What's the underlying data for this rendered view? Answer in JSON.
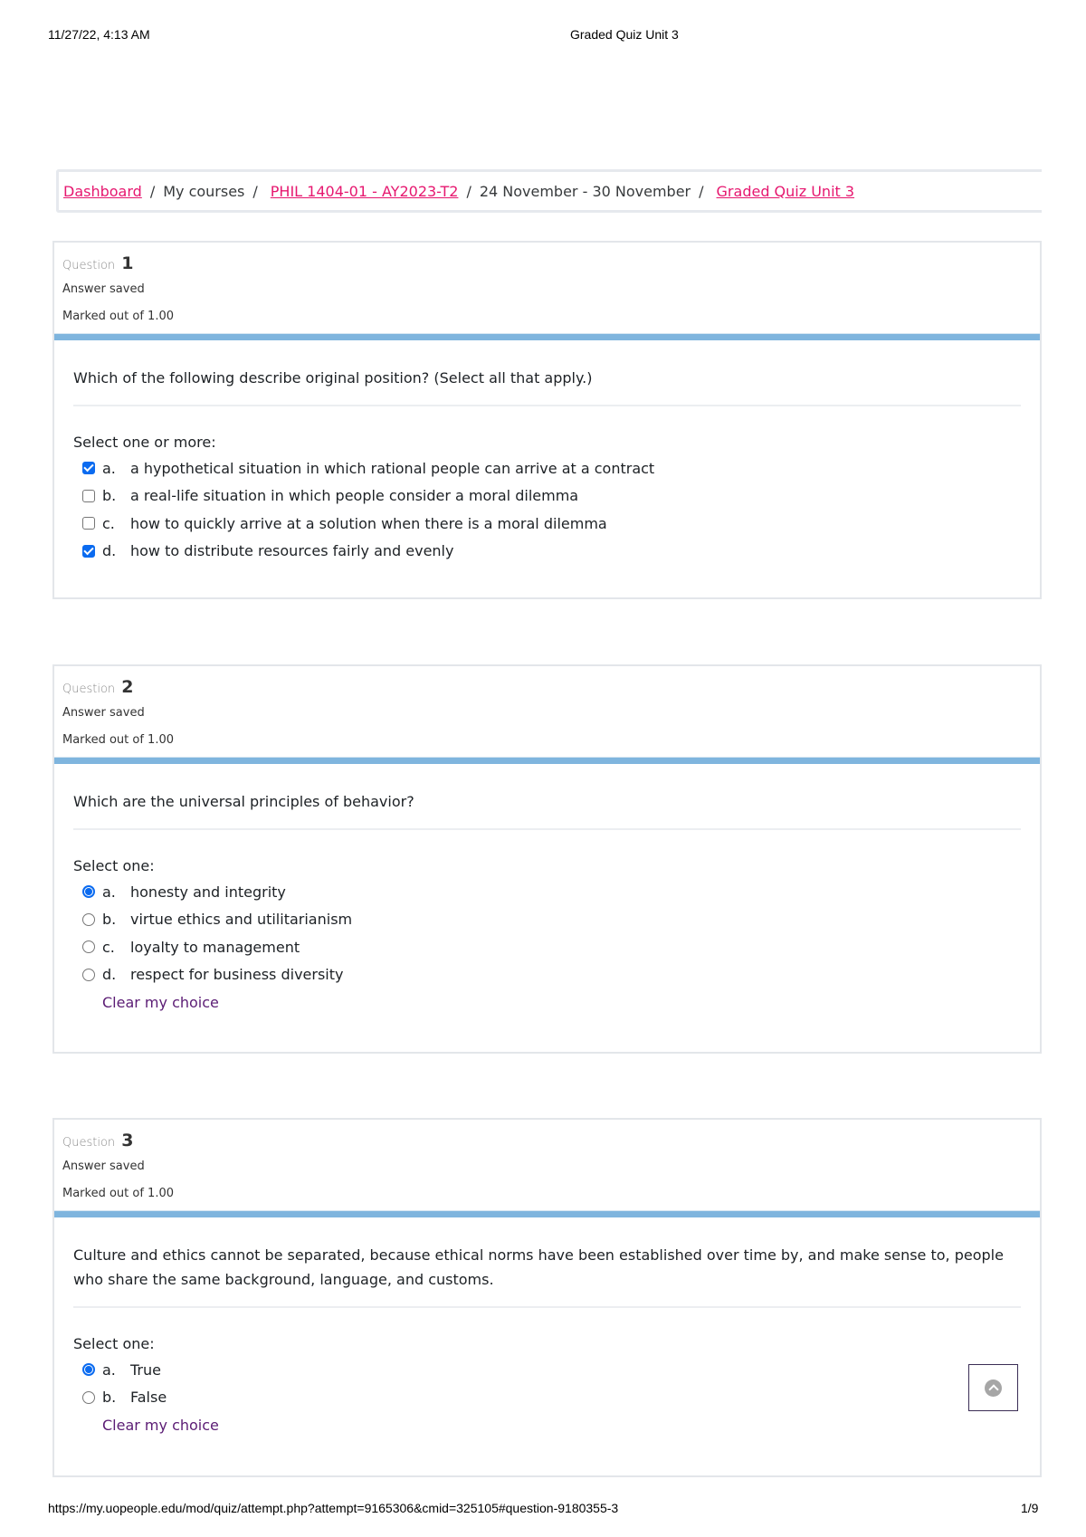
{
  "print_header": {
    "date": "11/27/22, 4:13 AM",
    "title": "Graded Quiz Unit 3"
  },
  "breadcrumb": [
    {
      "label": "Dashboard",
      "link": true
    },
    {
      "label": "My courses",
      "link": false
    },
    {
      "label": "PHIL 1404-01 - AY2023-T2",
      "link": true
    },
    {
      "label": "24 November - 30 November",
      "link": false
    },
    {
      "label": "Graded Quiz Unit 3",
      "link": true
    }
  ],
  "breadcrumb_separator": "/",
  "accent_color": "#e6176f",
  "questions": [
    {
      "label": "Question",
      "number": "1",
      "state": "Answer saved",
      "grade": "Marked out of 1.00",
      "text": "Which of the following describe original position? (Select all that apply.)",
      "prompt": "Select one or more:",
      "type": "checkbox",
      "answers": [
        {
          "letter": "a.",
          "text": "a hypothetical situation in which rational people can arrive at a contract",
          "selected": true
        },
        {
          "letter": "b.",
          "text": "a real-life situation in which people consider a moral dilemma",
          "selected": false
        },
        {
          "letter": "c.",
          "text": "how to quickly arrive at a solution when there is a moral dilemma",
          "selected": false
        },
        {
          "letter": "d.",
          "text": "how to distribute resources fairly and evenly",
          "selected": true
        }
      ]
    },
    {
      "label": "Question",
      "number": "2",
      "state": "Answer saved",
      "grade": "Marked out of 1.00",
      "text": "Which are the universal principles of behavior?",
      "prompt": "Select one:",
      "type": "radio",
      "answers": [
        {
          "letter": "a.",
          "text": "honesty and integrity",
          "selected": true
        },
        {
          "letter": "b.",
          "text": "virtue ethics and utilitarianism",
          "selected": false
        },
        {
          "letter": "c.",
          "text": "loyalty to management",
          "selected": false
        },
        {
          "letter": "d.",
          "text": "respect for business diversity",
          "selected": false
        }
      ],
      "clear_label": "Clear my choice"
    },
    {
      "label": "Question",
      "number": "3",
      "state": "Answer saved",
      "grade": "Marked out of 1.00",
      "text": "Culture and ethics cannot be separated, because ethical norms have been established over time by, and make sense to, people who share the same background, language, and customs.",
      "prompt": "Select one:",
      "type": "radio",
      "answers": [
        {
          "letter": "a.",
          "text": "True",
          "selected": true
        },
        {
          "letter": "b.",
          "text": "False",
          "selected": false
        }
      ],
      "clear_label": "Clear my choice"
    }
  ],
  "back_to_top_icon": "chevron-up-circle-icon",
  "print_footer": {
    "url": "https://my.uopeople.edu/mod/quiz/attempt.php?attempt=9165306&cmid=325105#question-9180355-3",
    "page": "1/9"
  }
}
